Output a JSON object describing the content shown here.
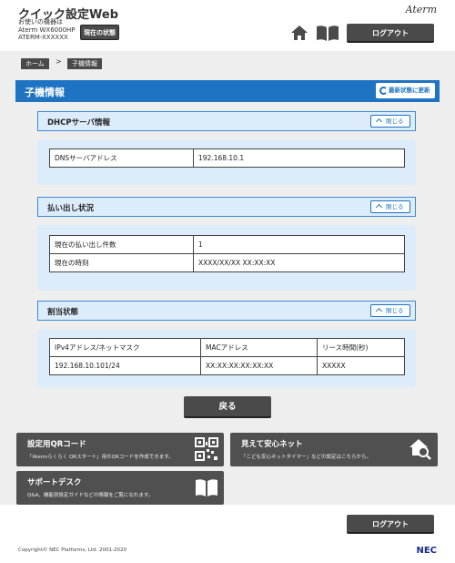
{
  "header": {
    "app_title": "クイック設定Web",
    "device_label": "お使いの機器は",
    "device_model": "Aterm WX6000HP",
    "device_id": "ATERM-XXXXXX",
    "status_button": "現在の状態",
    "brand": "Aterm",
    "logout": "ログアウト"
  },
  "breadcrumb": {
    "home": "ホーム",
    "separator": ">",
    "current": "子機情報"
  },
  "page": {
    "title": "子機情報",
    "refresh": "最新状態に更新"
  },
  "sections": {
    "dhcp": {
      "title": "DHCPサーバ情報",
      "close": "閉じる",
      "rows": [
        {
          "label": "DNSサーバアドレス",
          "value": "192.168.10.1"
        }
      ]
    },
    "lease": {
      "title": "払い出し状況",
      "close": "閉じる",
      "rows": [
        {
          "label": "現在の払い出し件数",
          "value": "1"
        },
        {
          "label": "現在の時刻",
          "value": "XXXX/XX/XX  XX:XX:XX"
        }
      ]
    },
    "assignment": {
      "title": "割当状態",
      "close": "閉じる",
      "headers": [
        "IPv4アドレス/ネットマスク",
        "MACアドレス",
        "リース時間(秒)"
      ],
      "rows": [
        [
          "192.168.10.101/24",
          "XX:XX:XX:XX:XX:XX",
          "XXXXX"
        ]
      ]
    }
  },
  "back_button": "戻る",
  "tiles": [
    {
      "title": "設定用QRコード",
      "desc": "「Atermらくらく QRスタート」用のQRコードを作成できます。",
      "icon": "qr-code-icon"
    },
    {
      "title": "見えて安心ネット",
      "desc": "「こども安心ネットタイマー」などの設定はこちらから。",
      "icon": "home-search-icon"
    },
    {
      "title": "サポートデスク",
      "desc": "Q&A、機能別設定ガイドなどの情報をご覧になれます。",
      "icon": "book-icon"
    }
  ],
  "footer": {
    "logout": "ログアウト",
    "copyright": "Copyright© NEC Platforms, Ltd. 2001-2020",
    "nec": "NEC"
  }
}
